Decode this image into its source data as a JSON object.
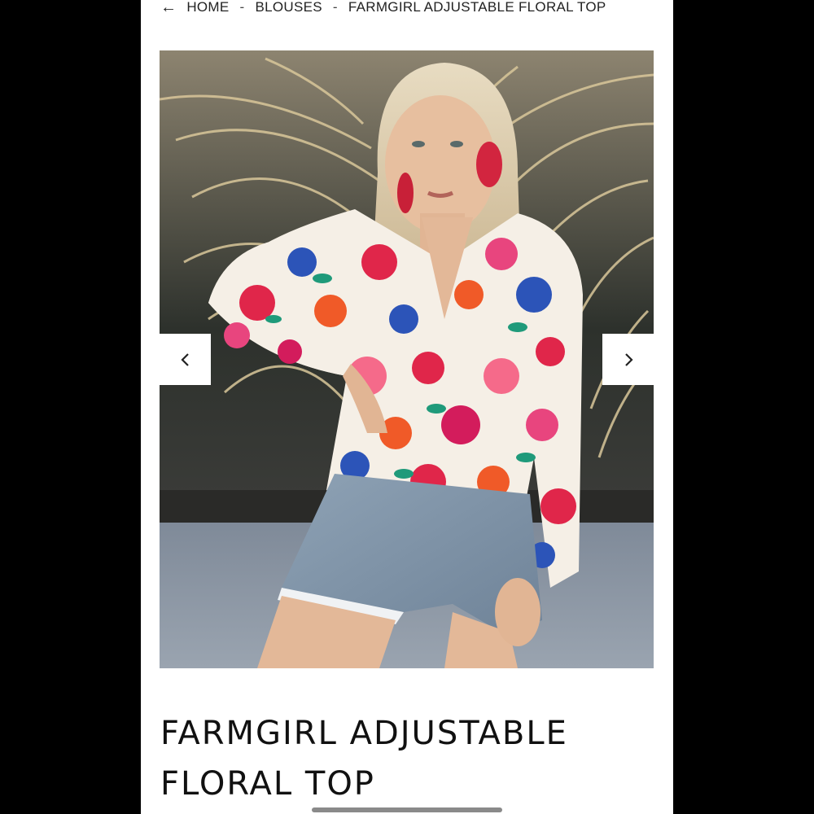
{
  "breadcrumb": {
    "back_icon": "arrow-left-icon",
    "items": [
      "HOME",
      "BLOUSES",
      "FARMGIRL ADJUSTABLE FLORAL TOP"
    ],
    "separator": "-"
  },
  "gallery": {
    "prev_icon": "chevron-left-icon",
    "next_icon": "chevron-right-icon"
  },
  "product": {
    "title_line1": "FARMGIRL ADJUSTABLE",
    "title_line2": "FLORAL TOP"
  }
}
